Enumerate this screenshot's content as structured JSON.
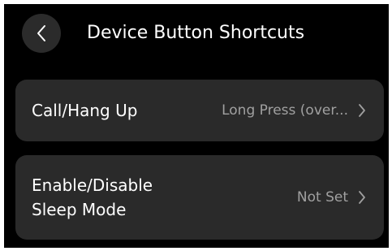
{
  "header": {
    "title": "Device Button Shortcuts",
    "back_icon": "chevron-left-icon"
  },
  "settings": [
    {
      "label": "Call/Hang Up",
      "value": "Long Press (over...",
      "icon": "chevron-right-icon"
    },
    {
      "label": "Enable/Disable Sleep Mode",
      "value": "Not Set",
      "icon": "chevron-right-icon"
    }
  ],
  "colors": {
    "background": "#000000",
    "card": "#2a2a2a",
    "back_button": "#2b2b2b",
    "primary_text": "#ffffff",
    "secondary_text": "#a0a0a0"
  }
}
